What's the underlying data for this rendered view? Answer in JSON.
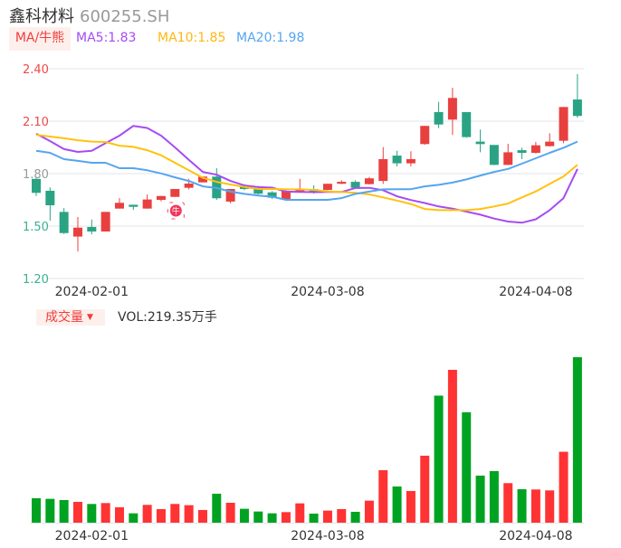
{
  "header": {
    "name": "鑫科材料",
    "code": "600255.SH"
  },
  "ma_bar": {
    "toggle_label": "MA/牛熊",
    "ma5": "MA5:1.83",
    "ma10": "MA10:1.85",
    "ma20": "MA20:1.98"
  },
  "volume_bar": {
    "toggle_label": "成交量",
    "vol_text": "VOL:219.35万手"
  },
  "marker_label": "牛",
  "colors": {
    "up": "#e8403f",
    "down": "#2aa384",
    "vol_up": "#ff3333",
    "vol_down": "#00a321",
    "ma5": "#a64bf4",
    "ma10": "#ffc20e",
    "ma20": "#55a5f0",
    "axis_up": "#f04848",
    "axis_mid": "#999999",
    "axis_down": "#3bb08f"
  },
  "chart_data": [
    {
      "type": "candlestick",
      "title": "鑫科材料 600255.SH",
      "y_ticks": [
        "2.40",
        "2.10",
        "1.80",
        "1.50",
        "1.20"
      ],
      "ylim": [
        1.2,
        2.4
      ],
      "grid": true,
      "x_tick_labels": [
        {
          "index": 4,
          "label": "2024-02-01"
        },
        {
          "index": 21,
          "label": "2024-03-08"
        },
        {
          "index": 36,
          "label": "2024-04-08"
        }
      ],
      "ohlc": [
        [
          1.77,
          1.69,
          1.775,
          1.672
        ],
        [
          1.702,
          1.619,
          1.721,
          1.531
        ],
        [
          1.581,
          1.46,
          1.603,
          1.455
        ],
        [
          1.44,
          1.491,
          1.552,
          1.355
        ],
        [
          1.495,
          1.469,
          1.538,
          1.453
        ],
        [
          1.469,
          1.581,
          1.581,
          1.469
        ],
        [
          1.6,
          1.633,
          1.66,
          1.6
        ],
        [
          1.622,
          1.61,
          1.622,
          1.593
        ],
        [
          1.6,
          1.652,
          1.681,
          1.6
        ],
        [
          1.65,
          1.672,
          1.672,
          1.641
        ],
        [
          1.667,
          1.712,
          1.712,
          1.667
        ],
        [
          1.719,
          1.743,
          1.77,
          1.71
        ],
        [
          1.75,
          1.783,
          1.783,
          1.75
        ],
        [
          1.783,
          1.659,
          1.831,
          1.65
        ],
        [
          1.64,
          1.712,
          1.712,
          1.63
        ],
        [
          1.73,
          1.712,
          1.74,
          1.705
        ],
        [
          1.712,
          1.685,
          1.73,
          1.68
        ],
        [
          1.693,
          1.662,
          1.7,
          1.655
        ],
        [
          1.65,
          1.7,
          1.705,
          1.645
        ],
        [
          1.693,
          1.707,
          1.77,
          1.69
        ],
        [
          1.711,
          1.699,
          1.733,
          1.686
        ],
        [
          1.707,
          1.742,
          1.742,
          1.705
        ],
        [
          1.742,
          1.753,
          1.762,
          1.74
        ],
        [
          1.753,
          1.719,
          1.762,
          1.715
        ],
        [
          1.74,
          1.773,
          1.781,
          1.738
        ],
        [
          1.758,
          1.883,
          1.952,
          1.741
        ],
        [
          1.903,
          1.859,
          1.931,
          1.841
        ],
        [
          1.859,
          1.883,
          1.928,
          1.841
        ],
        [
          1.969,
          2.073,
          2.073,
          1.965
        ],
        [
          2.152,
          2.081,
          2.21,
          2.06
        ],
        [
          2.109,
          2.233,
          2.291,
          2.021
        ],
        [
          2.152,
          2.009,
          2.152,
          2.005
        ],
        [
          1.983,
          1.969,
          2.052,
          1.922
        ],
        [
          1.964,
          1.85,
          1.964,
          1.848
        ],
        [
          1.85,
          1.922,
          1.971,
          1.848
        ],
        [
          1.934,
          1.919,
          1.948,
          1.883
        ],
        [
          1.919,
          1.962,
          1.981,
          1.915
        ],
        [
          1.957,
          1.983,
          2.031,
          1.955
        ],
        [
          1.988,
          2.181,
          2.181,
          1.974
        ],
        [
          2.224,
          2.13,
          2.37,
          2.12
        ]
      ],
      "series": [
        {
          "name": "MA5",
          "values": [
            2.028,
            1.986,
            1.94,
            1.924,
            1.931,
            1.975,
            2.017,
            2.073,
            2.061,
            2.017,
            1.95,
            1.879,
            1.81,
            1.794,
            1.758,
            1.732,
            1.723,
            1.72,
            1.697,
            1.695,
            1.694,
            1.695,
            1.695,
            1.718,
            1.719,
            1.705,
            1.67,
            1.649,
            1.632,
            1.612,
            1.6,
            1.583,
            1.565,
            1.543,
            1.526,
            1.519,
            1.539,
            1.591,
            1.66,
            1.827
          ]
        },
        {
          "name": "MA10",
          "values": [
            2.022,
            2.012,
            2.002,
            1.991,
            1.983,
            1.981,
            1.96,
            1.953,
            1.934,
            1.905,
            1.862,
            1.819,
            1.776,
            1.753,
            1.738,
            1.724,
            1.712,
            1.712,
            1.71,
            1.71,
            1.707,
            1.698,
            1.695,
            1.69,
            1.681,
            1.664,
            1.646,
            1.626,
            1.598,
            1.591,
            1.591,
            1.591,
            1.598,
            1.612,
            1.629,
            1.664,
            1.698,
            1.741,
            1.784,
            1.85
          ]
        },
        {
          "name": "MA20",
          "values": [
            1.931,
            1.919,
            1.883,
            1.873,
            1.862,
            1.862,
            1.831,
            1.831,
            1.819,
            1.801,
            1.779,
            1.758,
            1.727,
            1.718,
            1.697,
            1.684,
            1.675,
            1.668,
            1.65,
            1.65,
            1.65,
            1.65,
            1.66,
            1.684,
            1.697,
            1.71,
            1.711,
            1.711,
            1.727,
            1.736,
            1.749,
            1.767,
            1.789,
            1.81,
            1.827,
            1.857,
            1.888,
            1.919,
            1.948,
            1.983
          ]
        }
      ],
      "marker": {
        "index": 10,
        "label": "牛"
      }
    },
    {
      "type": "bar",
      "title": "成交量",
      "ylabel": "万手",
      "values": [
        32.4,
        31.6,
        30.0,
        27.6,
        24.8,
        26.0,
        20.4,
        12.4,
        23.6,
        18.0,
        24.8,
        23.2,
        16.8,
        38.4,
        26.4,
        18.4,
        14.8,
        12.4,
        14.0,
        25.6,
        12.0,
        16.0,
        18.0,
        14.4,
        29.2,
        69.6,
        48.0,
        42.0,
        88.8,
        168.4,
        202.6,
        146.4,
        62.4,
        68.4,
        52.4,
        44.4,
        44.0,
        42.8,
        94.0,
        219.35
      ],
      "x_tick_labels": [
        {
          "index": 4,
          "label": "2024-02-01"
        },
        {
          "index": 21,
          "label": "2024-03-08"
        },
        {
          "index": 36,
          "label": "2024-04-08"
        }
      ]
    }
  ]
}
